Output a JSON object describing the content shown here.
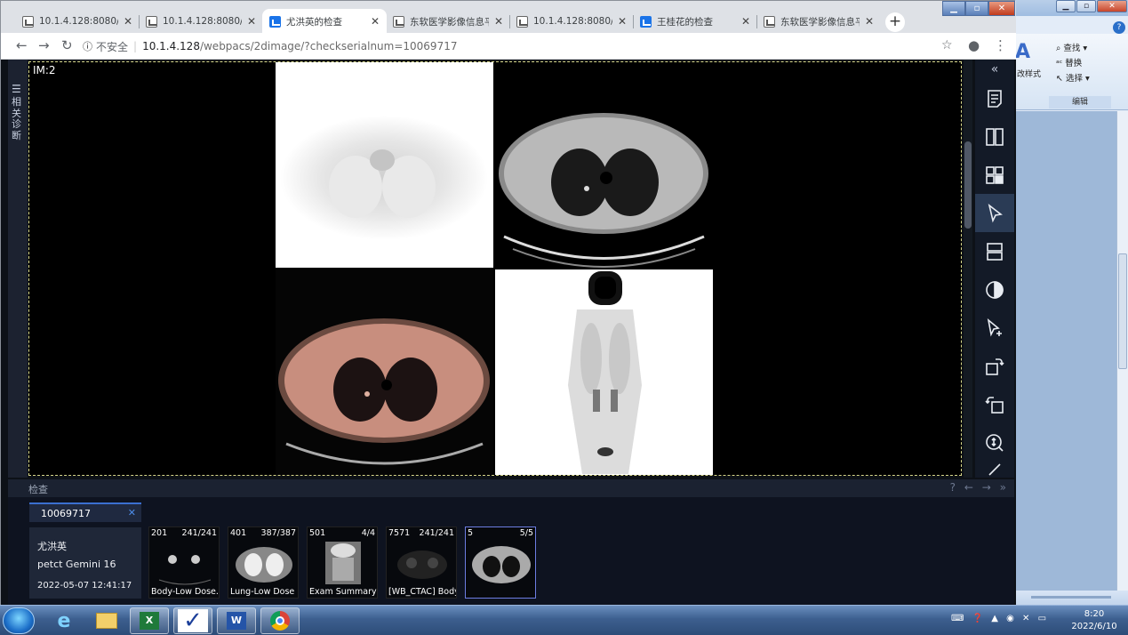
{
  "background_app": {
    "ribbon_items": [
      "查找",
      "替换",
      "选择"
    ],
    "ribbon_styles_label": "改样式",
    "ribbon_group": "编辑",
    "colors": {
      "frame": "#e3ecf8"
    }
  },
  "browser": {
    "tabs": [
      {
        "title": "10.1.4.128:8080/pa",
        "icon": "image-icon"
      },
      {
        "title": "10.1.4.128:8080/pa",
        "icon": "image-icon"
      },
      {
        "title": "尤洪英的检查",
        "icon": "app-icon",
        "active": true
      },
      {
        "title": "东软医学影像信息平",
        "icon": "image-icon"
      },
      {
        "title": "10.1.4.128:8080/pa",
        "icon": "image-icon"
      },
      {
        "title": "王桂花的检查",
        "icon": "app-icon"
      },
      {
        "title": "东软医学影像信息平",
        "icon": "image-icon"
      }
    ],
    "security_label": "不安全",
    "url_host": "10.1.4.128",
    "url_path": "/webpacs/2dimage/?checkserialnum=10069717"
  },
  "viewer": {
    "image_label": "IM:2",
    "left_panel_label": "相关诊断",
    "tools": [
      "collapse-icon",
      "report-icon",
      "split-layout-icon",
      "grid-layout-icon",
      "pointer-icon",
      "stack-layout-icon",
      "contrast-icon",
      "select-add-icon",
      "rotate-right-icon",
      "rotate-left-icon",
      "zoom-icon",
      "more-icon"
    ]
  },
  "exam": {
    "section_label": "检查",
    "tab_id": "10069717",
    "patient_name": "尤洪英",
    "device": "petct Gemini 16",
    "datetime": "2022-05-07 12:41:17",
    "series": [
      {
        "num": "201",
        "count": "241/241",
        "desc": "Body-Low Dose..."
      },
      {
        "num": "401",
        "count": "387/387",
        "desc": "Lung-Low Dose ..."
      },
      {
        "num": "501",
        "count": "4/4",
        "desc": "Exam Summary"
      },
      {
        "num": "7571",
        "count": "241/241",
        "desc": "[WB_CTAC] Body"
      },
      {
        "num": "5",
        "count": "5/5",
        "desc": ""
      }
    ]
  },
  "taskbar": {
    "time": "8:20",
    "date": "2022/6/10"
  }
}
